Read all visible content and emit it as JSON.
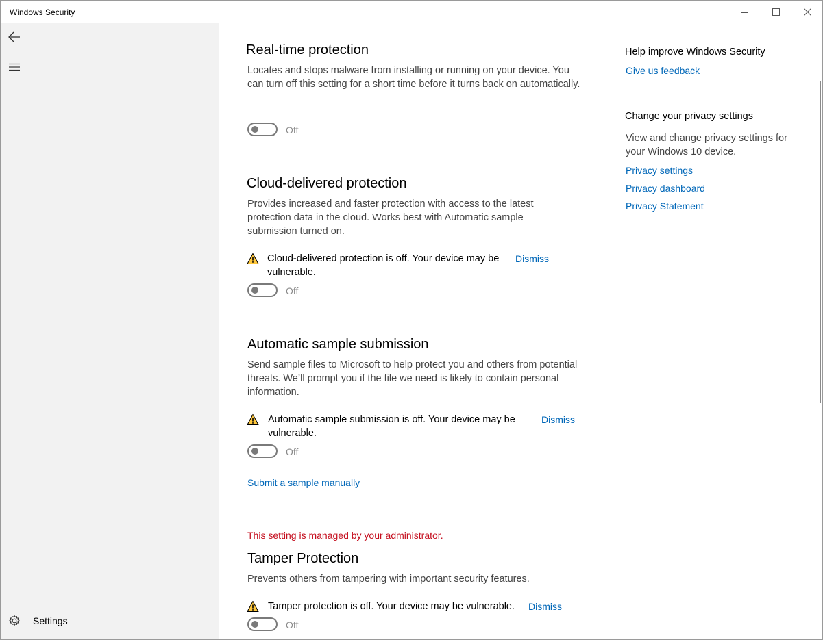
{
  "window": {
    "title": "Windows Security"
  },
  "sidebar": {
    "settings_label": "Settings"
  },
  "sections": [
    {
      "title": "Real-time protection",
      "description": "Locates and stops malware from installing or running on your device. You can turn off this setting for a short time before it turns back on automatically.",
      "toggle_state": "Off"
    },
    {
      "title": "Cloud-delivered protection",
      "description": "Provides increased and faster protection with access to the latest protection data in the cloud. Works best with Automatic sample submission turned on.",
      "warning": "Cloud-delivered protection is off. Your device may be vulnerable.",
      "dismiss_label": "Dismiss",
      "toggle_state": "Off"
    },
    {
      "title": "Automatic sample submission",
      "description": "Send sample files to Microsoft to help protect you and others from potential threats. We’ll prompt you if the file we need is likely to contain personal information.",
      "warning": "Automatic sample submission is off. Your device may be vulnerable.",
      "dismiss_label": "Dismiss",
      "toggle_state": "Off",
      "link": "Submit a sample manually"
    },
    {
      "admin_note": "This setting is managed by your administrator.",
      "title": "Tamper Protection",
      "description": "Prevents others from tampering with important security features.",
      "warning": "Tamper protection is off. Your device may be vulnerable.",
      "dismiss_label": "Dismiss",
      "toggle_state": "Off"
    }
  ],
  "right_panel": {
    "help_heading": "Help improve Windows Security",
    "feedback_link": "Give us feedback",
    "privacy_heading": "Change your privacy settings",
    "privacy_desc": "View and change privacy settings for your Windows 10 device.",
    "privacy_links": [
      "Privacy settings",
      "Privacy dashboard",
      "Privacy Statement"
    ]
  },
  "colors": {
    "link": "#0067b8",
    "admin_note": "#c50f1f",
    "sidebar_bg": "#f2f2f2",
    "warning": "#ffc83d"
  }
}
